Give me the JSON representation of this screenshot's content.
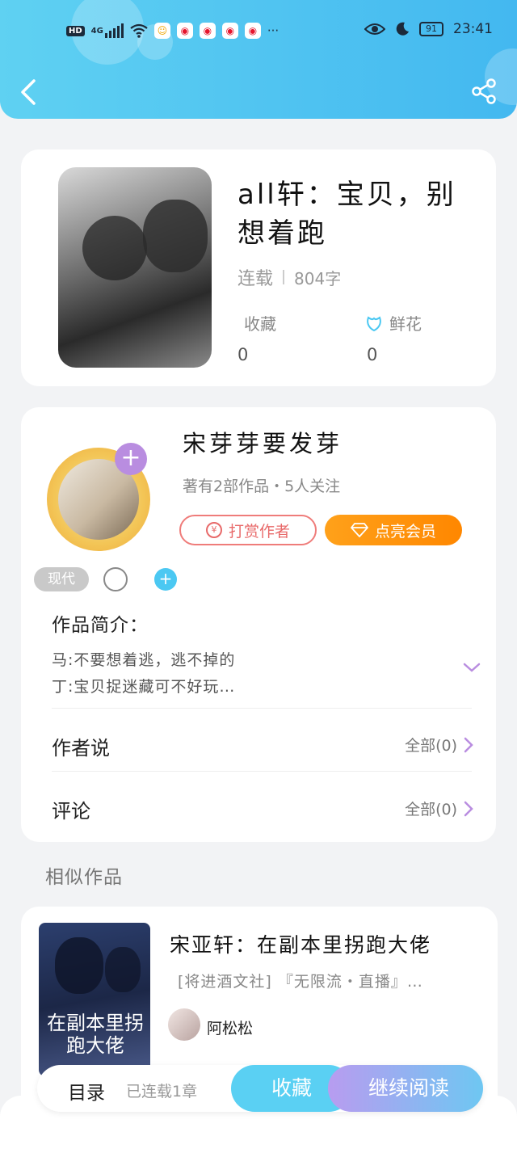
{
  "status_bar": {
    "network": "4G",
    "hd": "HD",
    "more": "···",
    "battery": "91",
    "time": "23:41"
  },
  "book": {
    "title": "all轩：宝贝，别想着跑",
    "status": "连载",
    "words": "804字",
    "collect_label": "收藏",
    "collect_count": "0",
    "flower_label": "鲜花",
    "flower_count": "0"
  },
  "author": {
    "name": "宋芽芽要发芽",
    "summary": "著有2部作品・5人关注",
    "tip_label": "打赏作者",
    "vip_label": "点亮会员",
    "tag": "现代"
  },
  "intro": {
    "title": "作品简介：",
    "line1": "马:不要想着逃，逃不掉的",
    "line2": "丁:宝贝捉迷藏可不好玩…"
  },
  "author_says": {
    "label": "作者说",
    "all": "全部(0)"
  },
  "comments": {
    "label": "评论",
    "all": "全部(0)"
  },
  "similar": {
    "heading": "相似作品",
    "title": "宋亚轩：在副本里拐跑大佬",
    "tags": "[将进酒文社] 『无限流・直播』…",
    "author": "阿松松",
    "cover_text": "在副本里拐跑大佬"
  },
  "bottom_bar": {
    "toc": "目录",
    "progress": "已连载1章",
    "favorite": "收藏",
    "continue": "继续阅读"
  },
  "colors": {
    "header": "#43b8f0",
    "accent_blue": "#5ad0f3",
    "vip_orange": "#ff8700",
    "tip_red": "#e86a6a",
    "purple": "#b98de0"
  }
}
